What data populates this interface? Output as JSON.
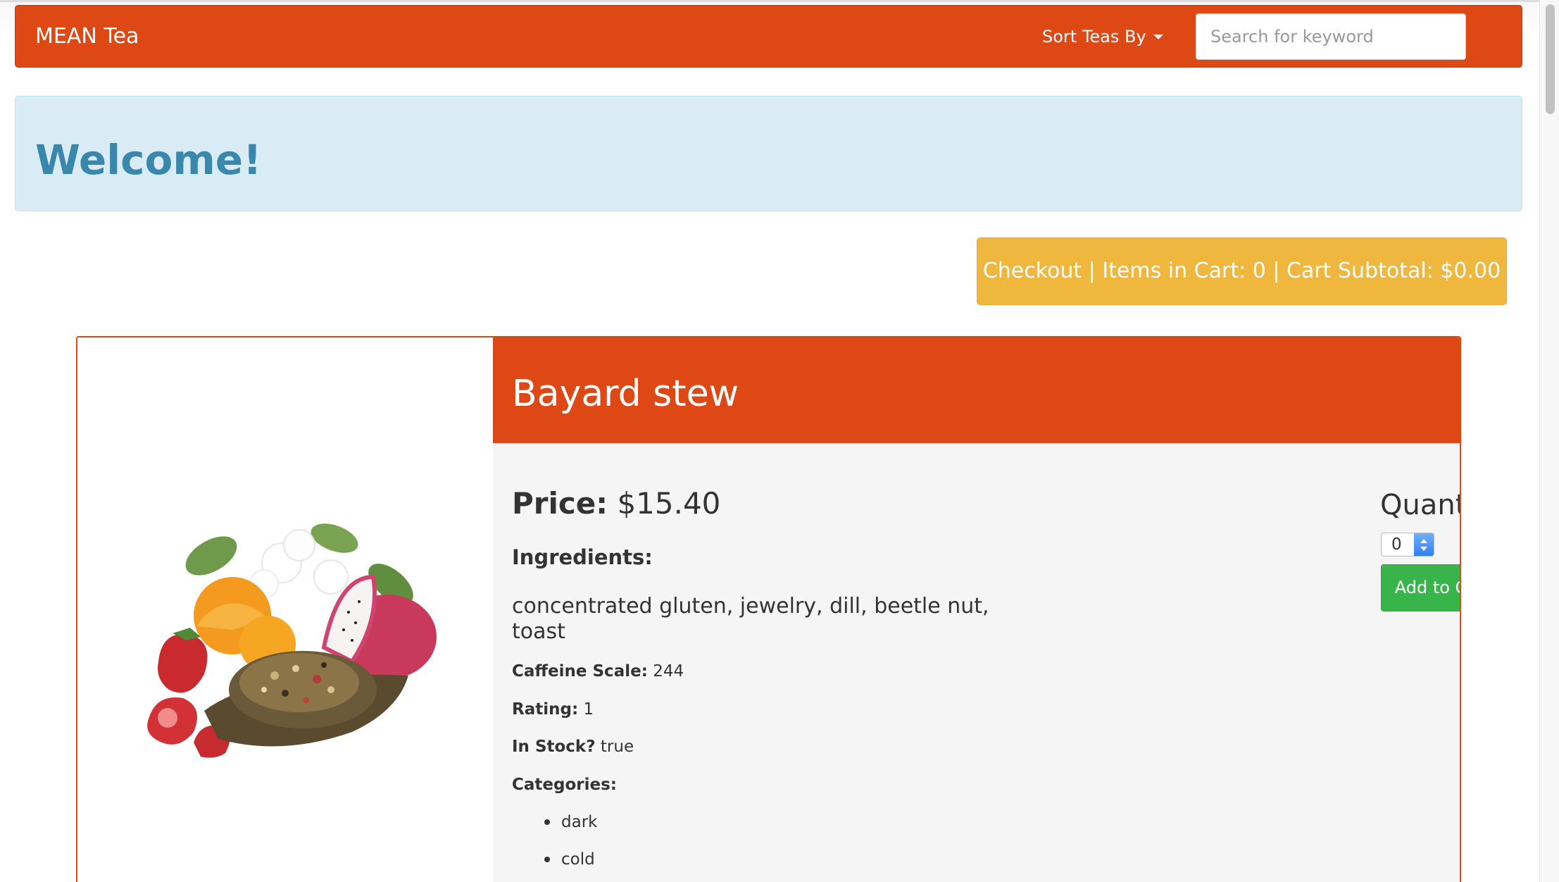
{
  "navbar": {
    "brand": "MEAN Tea",
    "sort_label": "Sort Teas By",
    "search_placeholder": "Search for keyword"
  },
  "welcome": {
    "heading": "Welcome!"
  },
  "checkout": {
    "label": "Checkout | Items in Cart: 0 | Cart Subtotal: $0.00"
  },
  "product": {
    "name": "Bayard stew",
    "price_label": "Price:",
    "price": "$15.40",
    "ingredients_label": "Ingredients:",
    "ingredients": "concentrated gluten, jewelry, dill, beetle nut, toast",
    "caffeine_label": "Caffeine Scale:",
    "caffeine": "244",
    "rating_label": "Rating:",
    "rating": "1",
    "in_stock_label": "In Stock?",
    "in_stock": "true",
    "categories_label": "Categories:",
    "categories": [
      "dark",
      "cold"
    ],
    "quantity_label": "Quantity:",
    "quantity_value": "0",
    "add_to_cart_label": "Add to Cart",
    "image_icon": "tea-product-image"
  },
  "colors": {
    "primary": "#dd4814",
    "info_bg": "#d9ecf5",
    "info_text": "#3a87ad",
    "warning": "#efb73e",
    "success": "#38b44a",
    "panel_bg": "#f5f5f5"
  }
}
